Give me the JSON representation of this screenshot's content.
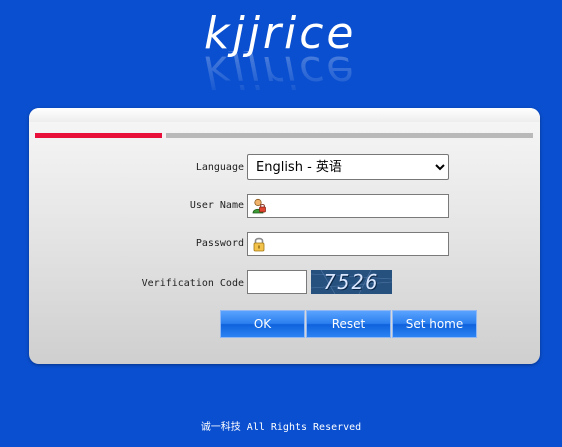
{
  "brand": {
    "logo_text": "kjjrice"
  },
  "form": {
    "language_label": "Language",
    "language_selected": "English - 英语",
    "username_label": "User Name",
    "username_value": "",
    "password_label": "Password",
    "password_value": "",
    "verification_label": "Verification Code",
    "verification_value": "",
    "captcha_text": "7526"
  },
  "buttons": {
    "ok_label": "OK",
    "reset_label": "Reset",
    "sethome_label": "Set home"
  },
  "footer": {
    "text": "诚一科技  All Rights Reserved"
  },
  "colors": {
    "background": "#0a4fcf",
    "accent_red": "#e8103a",
    "button_blue": "#2b7fef"
  },
  "icons": {
    "username_icon": "user-icon",
    "password_icon": "lock-icon"
  }
}
